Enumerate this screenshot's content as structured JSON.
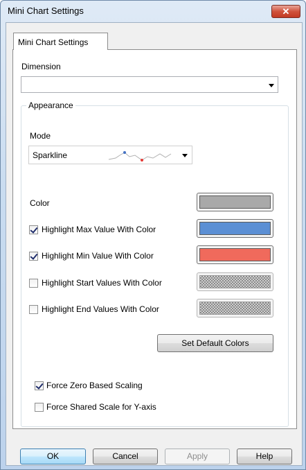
{
  "window": {
    "title": "Mini Chart Settings",
    "close_symbol": "✕"
  },
  "tab": {
    "label": "Mini Chart Settings"
  },
  "dimension": {
    "label": "Dimension",
    "value": ""
  },
  "appearance": {
    "legend": "Appearance",
    "mode_label": "Mode",
    "mode_value": "Sparkline",
    "color_label": "Color",
    "options": [
      {
        "label": "Highlight Max Value With Color",
        "checked": true,
        "color": "#5b8fd4"
      },
      {
        "label": "Highlight Min Value With Color",
        "checked": true,
        "color": "#f06a5c"
      },
      {
        "label": "Highlight Start Values With Color",
        "checked": false,
        "color": "hatched"
      },
      {
        "label": "Highlight End Values With Color",
        "checked": false,
        "color": "hatched"
      }
    ],
    "base_color": "#a9a9a9",
    "set_default_label": "Set Default Colors"
  },
  "scaling": {
    "force_zero_label": "Force Zero Based Scaling",
    "force_zero_checked": true,
    "shared_scale_label": "Force Shared Scale for Y-axis",
    "shared_scale_checked": false
  },
  "buttons": {
    "ok": "OK",
    "cancel": "Cancel",
    "apply": "Apply",
    "help": "Help"
  }
}
